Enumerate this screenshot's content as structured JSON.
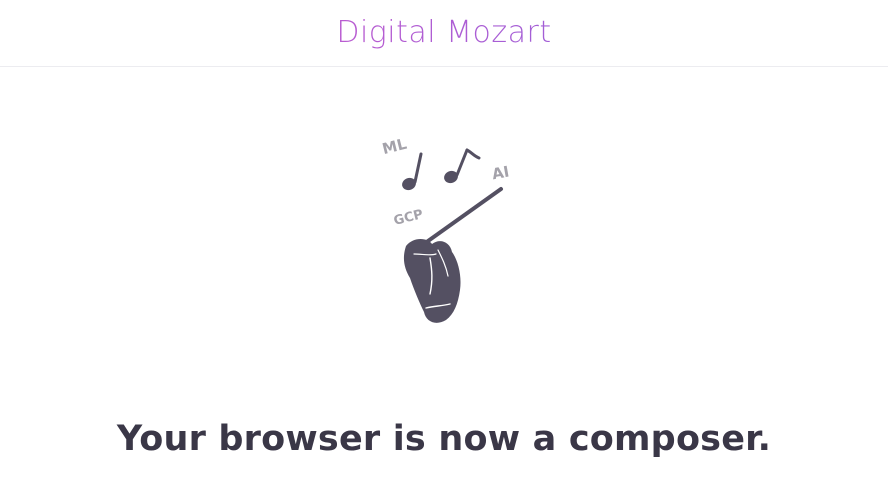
{
  "header": {
    "brand": "Digital Mozart"
  },
  "hero": {
    "illustration": {
      "icon": "conductor-hand-icon",
      "labels": [
        "ML",
        "AI",
        "GCP"
      ],
      "color": "#545062",
      "label_color": "#a4a2aa"
    },
    "tagline": "Your browser is now a composer."
  },
  "colors": {
    "brand_gradient_start": "#c15bcf",
    "brand_gradient_end": "#9b5fd8",
    "text_dark": "#3a3747",
    "divider": "#ececf0"
  }
}
